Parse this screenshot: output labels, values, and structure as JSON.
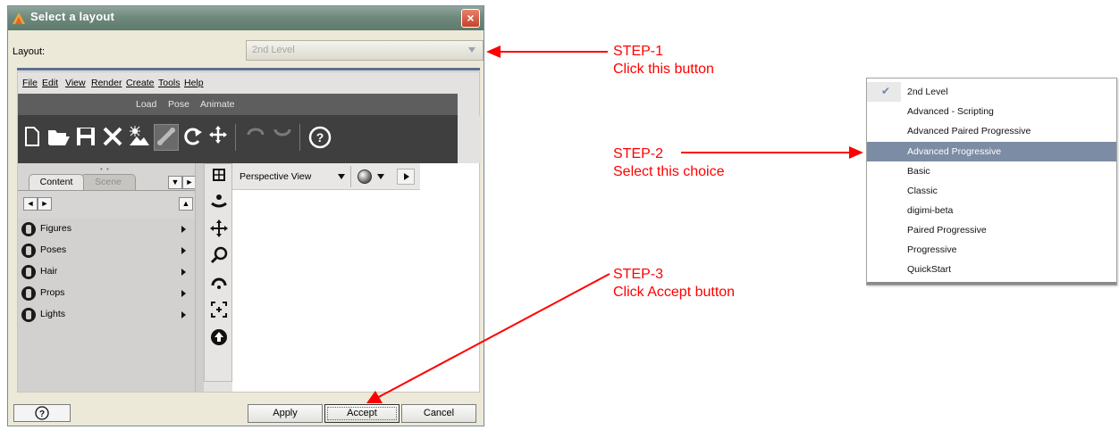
{
  "dialog": {
    "title": "Select a layout",
    "close_label": "×",
    "layout_label": "Layout:",
    "layout_value": "2nd Level"
  },
  "preview": {
    "menu": [
      "File",
      "Edit",
      "View",
      "Render",
      "Create",
      "Tools",
      "Help"
    ],
    "tabs": [
      "Load",
      "Pose",
      "Animate"
    ],
    "panel_tabs": [
      "Content",
      "Scene"
    ],
    "content_items": [
      "Figures",
      "Poses",
      "Hair",
      "Props",
      "Lights"
    ],
    "viewport_title": "Perspective View"
  },
  "buttons": {
    "help": "?",
    "apply": "Apply",
    "accept": "Accept",
    "cancel": "Cancel"
  },
  "dropdown": {
    "items": [
      "2nd Level",
      "Advanced - Scripting",
      "Advanced Paired Progressive",
      "Advanced Progressive",
      "Basic",
      "Classic",
      "digimi-beta",
      "Paired Progressive",
      "Progressive",
      "QuickStart"
    ],
    "checked_index": 0,
    "selected_index": 3
  },
  "annotations": {
    "step1_title": "STEP-1",
    "step1_text": "Click this button",
    "step2_title": "STEP-2",
    "step2_text": "Select this choice",
    "step3_title": "STEP-3",
    "step3_text": "Click Accept button"
  },
  "colors": {
    "annotation": "#ff0000",
    "selected_row": "#7c8ca4",
    "title_bar": "#6f8a7d"
  }
}
